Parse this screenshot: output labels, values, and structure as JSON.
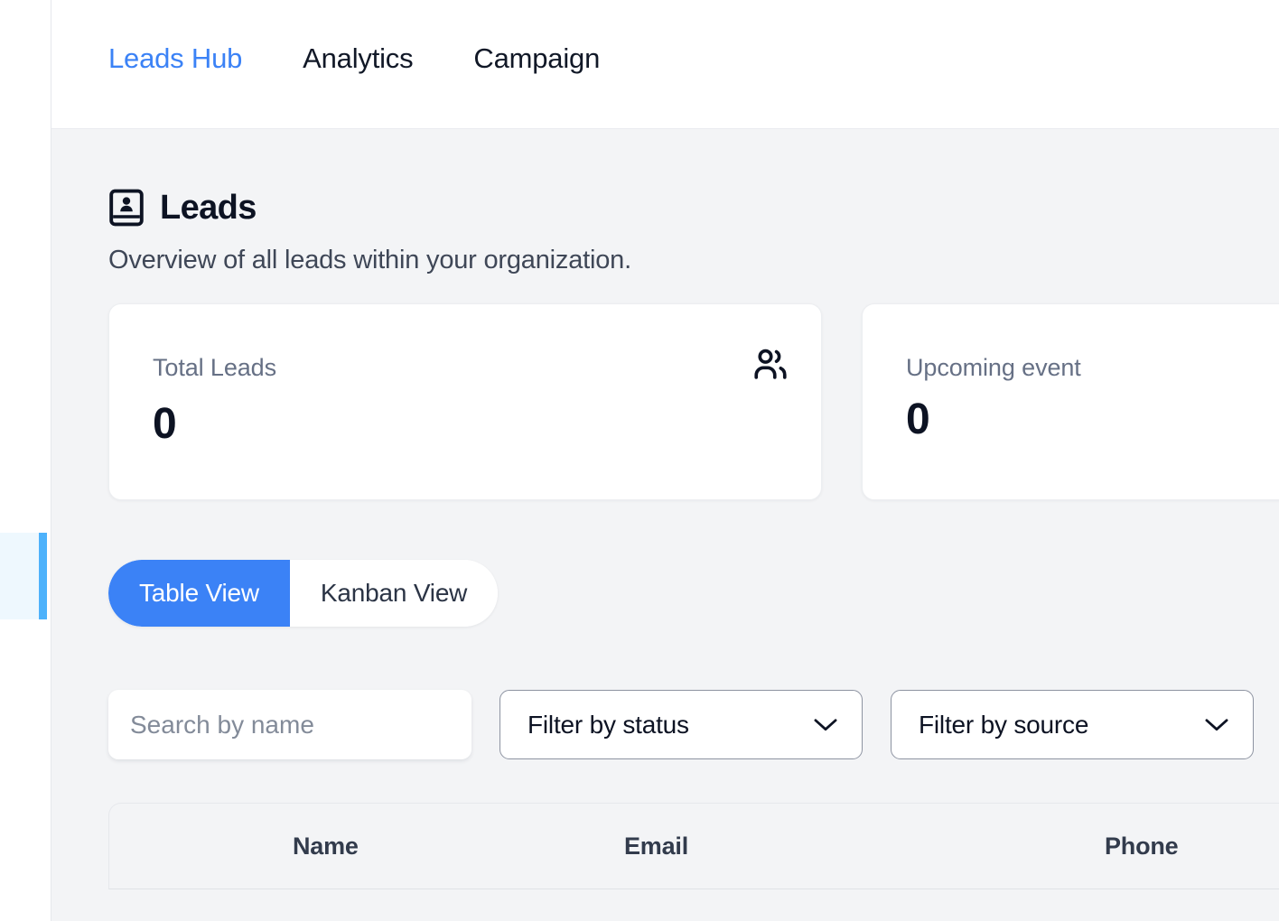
{
  "nav": {
    "tabs": [
      {
        "label": "Leads Hub",
        "active": true
      },
      {
        "label": "Analytics",
        "active": false
      },
      {
        "label": "Campaign",
        "active": false
      }
    ]
  },
  "page": {
    "icon": "contact-book-icon",
    "title": "Leads",
    "subtitle": "Overview of all leads within your organization."
  },
  "stats": [
    {
      "label": "Total Leads",
      "value": "0",
      "icon": "users-icon"
    },
    {
      "label": "Upcoming event",
      "value": "0",
      "icon": ""
    }
  ],
  "view_toggle": {
    "options": [
      {
        "label": "Table View",
        "active": true
      },
      {
        "label": "Kanban View",
        "active": false
      }
    ]
  },
  "filters": {
    "search": {
      "placeholder": "Search by name",
      "value": ""
    },
    "status": {
      "label": "Filter by status"
    },
    "source": {
      "label": "Filter by source"
    }
  },
  "table": {
    "columns": [
      "Name",
      "Email",
      "Phone"
    ],
    "rows": []
  },
  "colors": {
    "accent": "#3b82f6",
    "sidebar_active_bg": "#eef8fe",
    "sidebar_active_bar": "#4db2fb",
    "page_bg": "#f3f4f6",
    "card_bg": "#ffffff",
    "text_primary": "#0d1323",
    "text_muted": "#667085"
  }
}
